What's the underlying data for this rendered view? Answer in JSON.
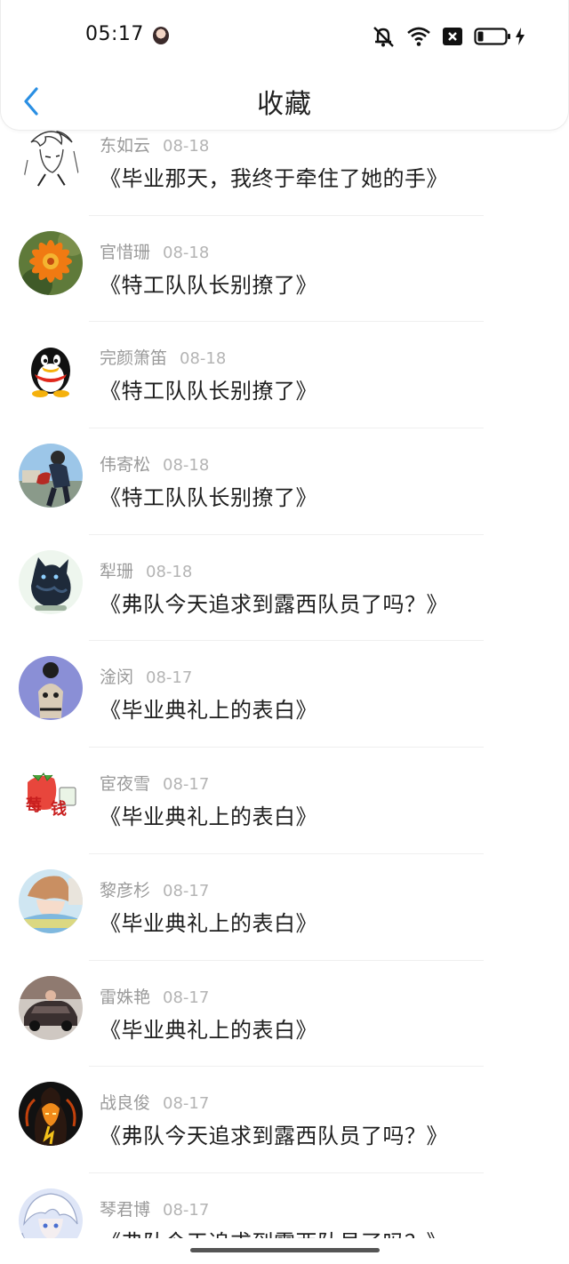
{
  "status_bar": {
    "time": "05:17",
    "icons": [
      "mute-bell-icon",
      "wifi-icon",
      "close-box-icon",
      "battery-icon",
      "charging-bolt-icon"
    ]
  },
  "header": {
    "title": "收藏",
    "back_icon": "chevron-left-icon",
    "accent_color": "#2a8fe3"
  },
  "favorites": [
    {
      "user": "东如云",
      "date": "08-18",
      "title": "《毕业那天，我终于牵住了她的手》",
      "avatar": "anime-sketch-avatar"
    },
    {
      "user": "官惜珊",
      "date": "08-18",
      "title": "《特工队队长别撩了》",
      "avatar": "orange-flower-avatar"
    },
    {
      "user": "完颜箫笛",
      "date": "08-18",
      "title": "《特工队队长别撩了》",
      "avatar": "penguin-avatar"
    },
    {
      "user": "伟寄松",
      "date": "08-18",
      "title": "《特工队队长别撩了》",
      "avatar": "person-outdoor-avatar"
    },
    {
      "user": "犁珊",
      "date": "08-18",
      "title": "《弗队今天追求到露西队员了吗？》",
      "avatar": "black-cat-avatar"
    },
    {
      "user": "淦闵",
      "date": "08-17",
      "title": "《毕业典礼上的表白》",
      "avatar": "figure-purple-avatar"
    },
    {
      "user": "宦夜雪",
      "date": "08-17",
      "title": "《毕业典礼上的表白》",
      "avatar": "strawberry-money-avatar"
    },
    {
      "user": "黎彦杉",
      "date": "08-17",
      "title": "《毕业典礼上的表白》",
      "avatar": "anime-boy-avatar"
    },
    {
      "user": "雷姝艳",
      "date": "08-17",
      "title": "《毕业典礼上的表白》",
      "avatar": "car-avatar"
    },
    {
      "user": "战良俊",
      "date": "08-17",
      "title": "《弗队今天追求到露西队员了吗？》",
      "avatar": "flame-figure-avatar"
    },
    {
      "user": "琴君博",
      "date": "08-17",
      "title": "《弗队今天追求到露西队员了吗？》",
      "avatar": "white-hair-avatar"
    }
  ]
}
